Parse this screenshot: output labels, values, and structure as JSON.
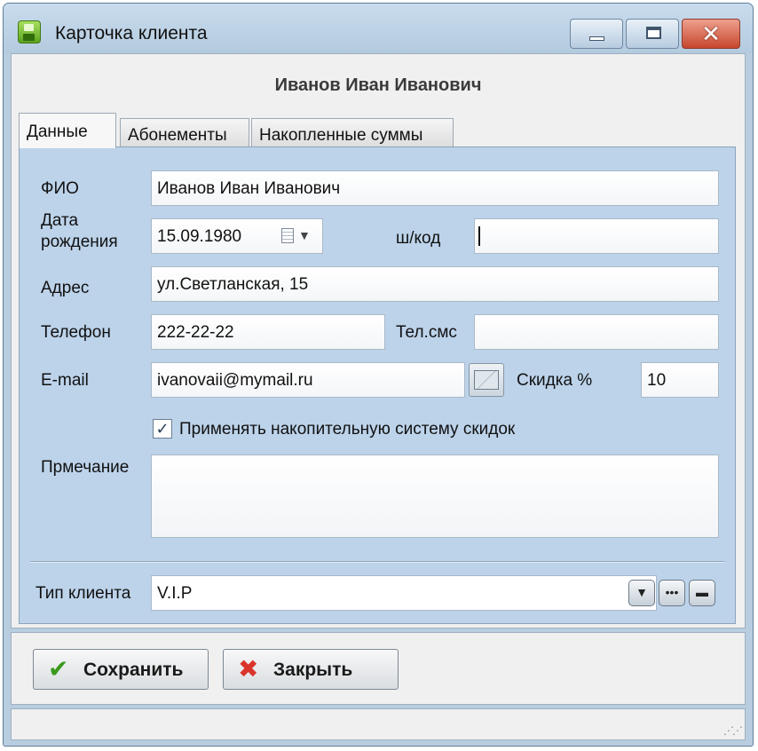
{
  "window": {
    "title": "Карточка клиента",
    "icon": "app-save-icon"
  },
  "header": {
    "client_name": "Иванов Иван Иванович"
  },
  "tabs": [
    {
      "label": "Данные",
      "active": true
    },
    {
      "label": "Абонементы",
      "active": false
    },
    {
      "label": "Накопленные суммы",
      "active": false
    }
  ],
  "form": {
    "fio": {
      "label": "ФИО",
      "value": "Иванов Иван Иванович"
    },
    "birth": {
      "label_line1": "Дата",
      "label_line2": "рождения",
      "value": "15.09.1980",
      "icon": "calendar-icon"
    },
    "barcode": {
      "label": "ш/код",
      "value": ""
    },
    "address": {
      "label": "Адрес",
      "value": "ул.Светланская, 15"
    },
    "phone": {
      "label": "Телефон",
      "value": "222-22-22"
    },
    "sms_phone": {
      "label": "Тел.смс",
      "value": ""
    },
    "email": {
      "label": "E-mail",
      "value": "ivanovaii@mymail.ru",
      "button_icon": "envelope-icon"
    },
    "discount": {
      "label": "Скидка %",
      "value": "10"
    },
    "cumulative": {
      "label": "Применять накопительную систему скидок",
      "checked": true
    },
    "note": {
      "label": "Прмечание",
      "value": ""
    },
    "client_type": {
      "label": "Тип клиента",
      "value": "V.I.P"
    }
  },
  "buttons": {
    "save": {
      "label": "Сохранить",
      "icon": "checkmark-icon"
    },
    "close": {
      "label": "Закрыть",
      "icon": "cross-icon"
    }
  },
  "colors": {
    "panel": "#bcd3ea",
    "titlebar": "#b9cde0",
    "close_button": "#c7462d"
  }
}
